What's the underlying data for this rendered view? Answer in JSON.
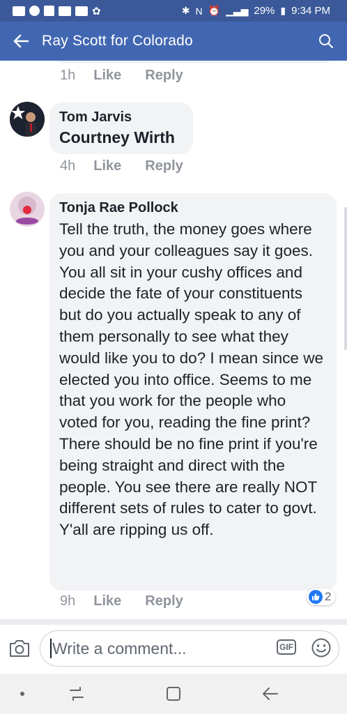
{
  "status_bar": {
    "battery": "29%",
    "time": "9:34 PM"
  },
  "app_bar": {
    "title": "Ray Scott for Colorado"
  },
  "comments": [
    {
      "time": "1h",
      "like_label": "Like",
      "reply_label": "Reply"
    },
    {
      "author": "Tom Jarvis",
      "text": "Courtney Wirth",
      "time": "4h",
      "like_label": "Like",
      "reply_label": "Reply"
    },
    {
      "author": "Tonja Rae Pollock",
      "text": "Tell the truth, the money goes where you and your colleagues say it goes. You all sit in your cushy offices and decide the fate of your constituents but do you actually speak to any of them personally to see what they would like you to do? I mean since we elected you into office. Seems to me that you work for the people who voted for you, reading the fine print? There should be no fine print if you're  being straight and direct with the people. You see there are really NOT different sets of rules to cater to govt. Y'all are ripping us off.",
      "time": "9h",
      "like_label": "Like",
      "reply_label": "Reply",
      "reaction_count": "2"
    }
  ],
  "composer": {
    "placeholder": "Write a comment...",
    "gif_label": "GIF"
  },
  "colors": {
    "brand_blue": "#4267b2",
    "status_blue": "#3b5998",
    "bubble_gray": "#f2f3f5",
    "like_blue": "#2078f4"
  }
}
